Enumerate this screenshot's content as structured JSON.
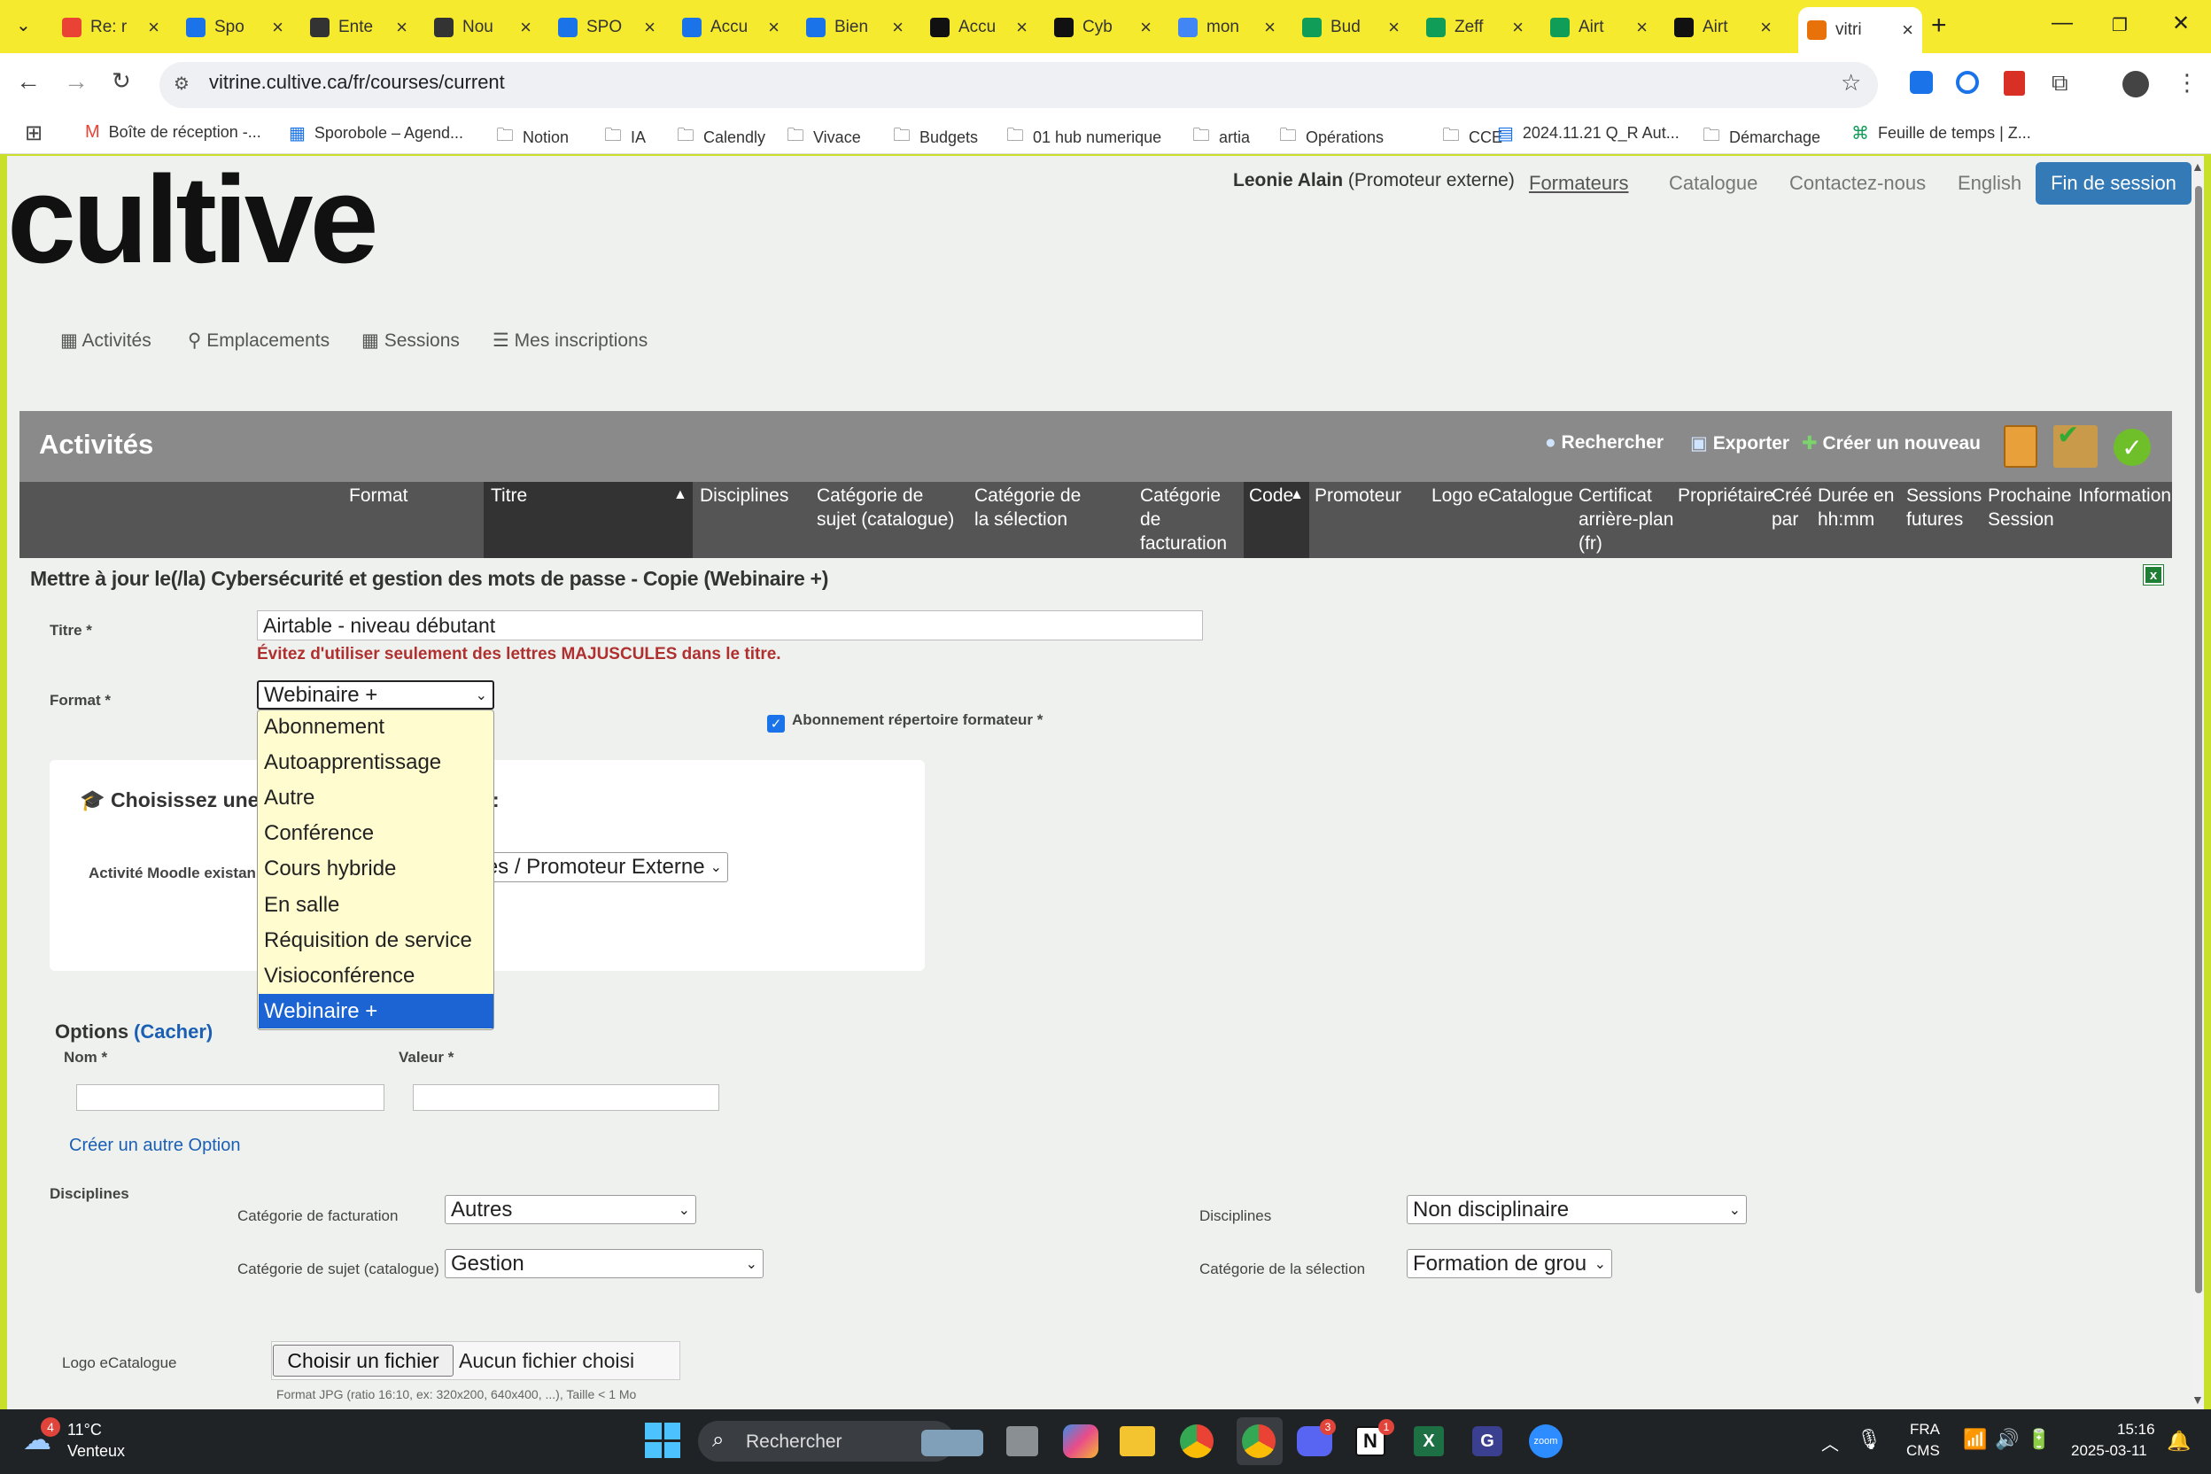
{
  "tabs": [
    {
      "label": "Re: r",
      "icon": "gmail-icon",
      "color": "#ea4335"
    },
    {
      "label": "Spo",
      "icon": "calendar-icon",
      "color": "#1a73e8"
    },
    {
      "label": "Ente",
      "icon": "film-icon",
      "color": "#333333"
    },
    {
      "label": "Nou",
      "icon": "film-icon",
      "color": "#333333"
    },
    {
      "label": "SPO",
      "icon": "chatgpt-icon",
      "color": "#1a73e8"
    },
    {
      "label": "Accu",
      "icon": "circle-icon",
      "color": "#1a73e8"
    },
    {
      "label": "Bien",
      "icon": "chatgpt-icon",
      "color": "#1a73e8"
    },
    {
      "label": "Accu",
      "icon": "o1-icon",
      "color": "#111111"
    },
    {
      "label": "Cyb",
      "icon": "o1-icon",
      "color": "#111111"
    },
    {
      "label": "mon",
      "icon": "google-icon",
      "color": "#4285f4"
    },
    {
      "label": "Bud",
      "icon": "sheets-icon",
      "color": "#0f9d58"
    },
    {
      "label": "Zeff",
      "icon": "chatgpt-icon",
      "color": "#0f9d58"
    },
    {
      "label": "Airt",
      "icon": "chatgpt-icon",
      "color": "#0f9d58"
    },
    {
      "label": "Airt",
      "icon": "o1-icon",
      "color": "#111111"
    },
    {
      "label": "vitri",
      "icon": "cultive-icon",
      "color": "#e8710a"
    }
  ],
  "url": "vitrine.cultive.ca/fr/courses/current",
  "bookmarks": [
    "Boîte de réception -...",
    "Sporobole – Agend...",
    "Notion",
    "IA",
    "Calendly",
    "Vivace",
    "Budgets",
    "01 hub numerique",
    "artia",
    "Opérations",
    "CCE",
    "2024.11.21 Q_R Aut...",
    "Démarchage",
    "Feuille de temps | Z..."
  ],
  "user": {
    "name": "Leonie Alain",
    "role": "(Promoteur externe)"
  },
  "topnav": {
    "formateurs": "Formateurs",
    "catalogue": "Catalogue",
    "contact": "Contactez-nous",
    "lang": "English",
    "logout": "Fin de session"
  },
  "logo": "cultive",
  "menu": [
    "Activités",
    "Emplacements",
    "Sessions",
    "Mes inscriptions"
  ],
  "grid": {
    "title": "Activités",
    "actions": {
      "search": "Rechercher",
      "export": "Exporter",
      "create": "Créer un nouveau"
    },
    "columns": [
      "Format",
      "Titre",
      "Disciplines",
      "Catégorie de sujet (catalogue)",
      "Catégorie de la sélection",
      "Catégorie de facturation",
      "Code",
      "Promoteur",
      "Logo eCatalogue",
      "Certificat arrière-plan (fr)",
      "Propriétaire",
      "Créé par",
      "Durée en hh:mm",
      "Sessions futures",
      "Prochaine Session",
      "Information"
    ]
  },
  "form": {
    "heading": "Mettre à jour le(/la) Cybersécurité et gestion des mots de passe - Copie (Webinaire +)",
    "titre_label": "Titre *",
    "titre_value": "Airtable - niveau débutant",
    "titre_warning": "Évitez d'utiliser seulement des lettres MAJUSCULES dans le titre.",
    "format_label": "Format *",
    "format_value": "Webinaire +",
    "format_options": [
      "Abonnement",
      "Autoapprentissage",
      "Autre",
      "Conférence",
      "Cours hybride",
      "En salle",
      "Réquisition de service",
      "Visioconférence",
      "Webinaire +"
    ],
    "abonnement_label": "Abonnement répertoire formateur *",
    "choose_heading": "Choisissez une a",
    "choose_heading_tail": ":",
    "moodle_label": "Activité Moodle existan",
    "moodle_value": "es / Promoteur Externe",
    "options_label": "Options",
    "options_toggle": "(Cacher)",
    "nom_label": "Nom *",
    "valeur_label": "Valeur *",
    "create_option": "Créer un autre Option",
    "disciplines_section": "Disciplines",
    "cat_fact_label": "Catégorie de facturation",
    "cat_fact_value": "Autres",
    "cat_sujet_label": "Catégorie de sujet (catalogue)",
    "cat_sujet_value": "Gestion",
    "disciplines_label": "Disciplines",
    "disciplines_value": "Non disciplinaire",
    "cat_sel_label": "Catégorie de la sélection",
    "cat_sel_value": "Formation de grou",
    "logo_label": "Logo eCatalogue",
    "file_button": "Choisir un fichier",
    "file_none": "Aucun fichier choisi",
    "file_hint": "Format JPG (ratio 16:10, ex: 320x200, 640x400, ...), Taille < 1 Mo"
  },
  "taskbar": {
    "weather_temp": "11°C",
    "weather_desc": "Venteux",
    "weather_badge": "4",
    "search": "Rechercher",
    "lang1": "FRA",
    "lang2": "CMS",
    "time": "15:16",
    "date": "2025-03-11"
  }
}
